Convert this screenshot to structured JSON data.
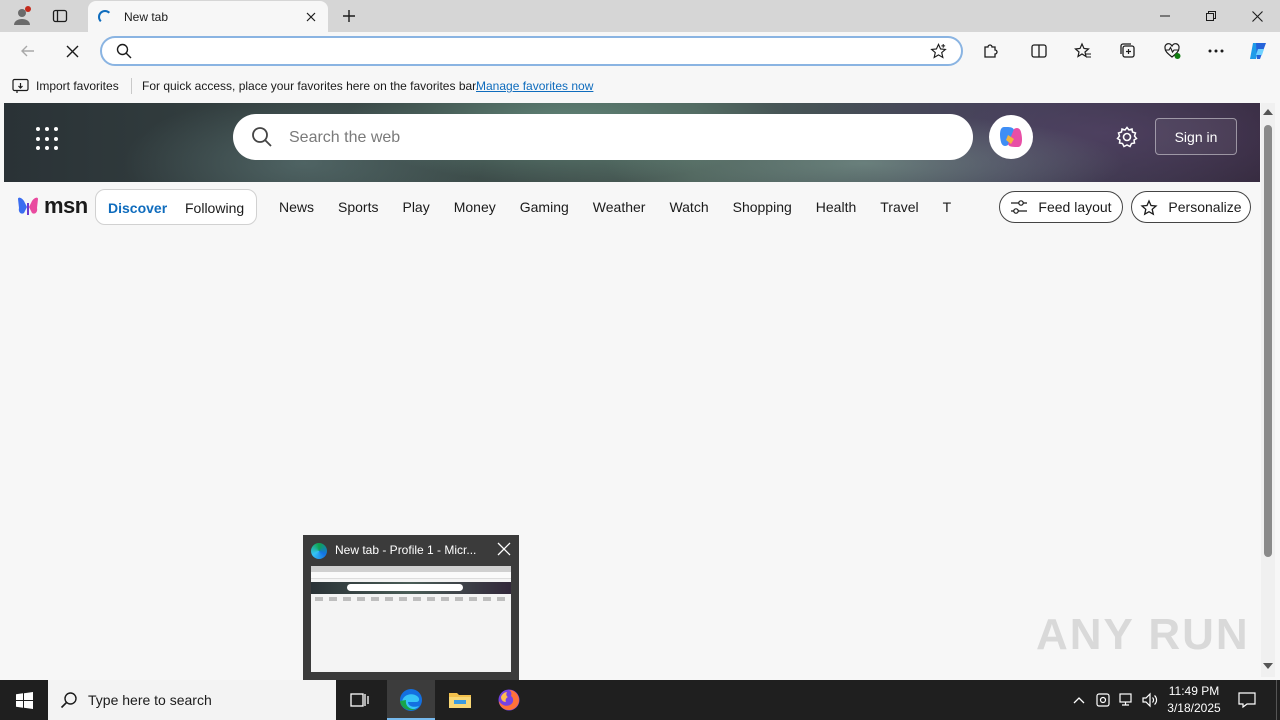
{
  "browser": {
    "tab": {
      "title": "New tab"
    },
    "address_bar": {
      "value": "",
      "placeholder": ""
    },
    "favorites_bar": {
      "import_label": "Import favorites",
      "hint": "For quick access, place your favorites here on the favorites bar.",
      "manage_link": "Manage favorites now"
    }
  },
  "msn": {
    "search_placeholder": "Search the web",
    "sign_in": "Sign in",
    "logo_text": "msn",
    "pill": {
      "discover": "Discover",
      "following": "Following"
    },
    "nav": [
      "News",
      "Sports",
      "Play",
      "Money",
      "Gaming",
      "Weather",
      "Watch",
      "Shopping",
      "Health",
      "Travel",
      "Traffic"
    ],
    "feed_layout": "Feed layout",
    "personalize": "Personalize"
  },
  "taskbar_preview": {
    "title": "New tab - Profile 1 - Micr..."
  },
  "watermark": "ANY RUN",
  "taskbar": {
    "search_placeholder": "Type here to search",
    "time": "11:49 PM",
    "date": "3/18/2025"
  },
  "colors": {
    "accent": "#0f6cbd",
    "taskbar": "#1f1f1f"
  }
}
